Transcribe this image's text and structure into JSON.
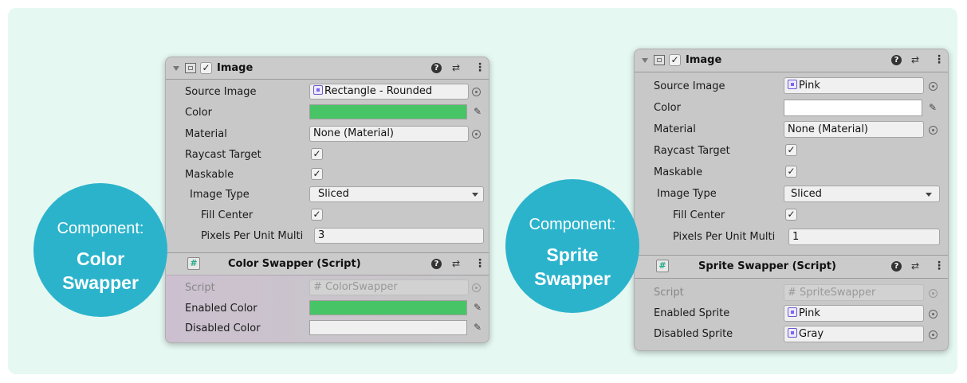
{
  "left": {
    "badge": {
      "line1": "Component:",
      "line2": "Color",
      "line3": "Swapper"
    },
    "image_component": {
      "title": "Image",
      "source_image": {
        "label": "Source Image",
        "value": "Rectangle - Rounded"
      },
      "color": {
        "label": "Color",
        "value_hex": "#47c566"
      },
      "material": {
        "label": "Material",
        "value": "None (Material)"
      },
      "raycast": {
        "label": "Raycast Target",
        "checked": "✓"
      },
      "maskable": {
        "label": "Maskable",
        "checked": "✓"
      },
      "image_type": {
        "label": "Image Type",
        "value": "Sliced"
      },
      "fill_center": {
        "label": "Fill Center",
        "checked": "✓"
      },
      "ppu": {
        "label": "Pixels Per Unit Multi",
        "value": "3"
      }
    },
    "script_component": {
      "title": "Color Swapper (Script)",
      "script": {
        "label": "Script",
        "value": "ColorSwapper"
      },
      "enabled": {
        "label": "Enabled Color",
        "value_hex": "#47c566"
      },
      "disabled": {
        "label": "Disabled Color",
        "value_hex": "#f0f0f0"
      }
    }
  },
  "right": {
    "badge": {
      "line1": "Component:",
      "line2": "Sprite",
      "line3": "Swapper"
    },
    "image_component": {
      "title": "Image",
      "source_image": {
        "label": "Source Image",
        "value": "Pink"
      },
      "color": {
        "label": "Color",
        "value_hex": "#ffffff"
      },
      "material": {
        "label": "Material",
        "value": "None (Material)"
      },
      "raycast": {
        "label": "Raycast Target",
        "checked": "✓"
      },
      "maskable": {
        "label": "Maskable",
        "checked": "✓"
      },
      "image_type": {
        "label": "Image Type",
        "value": "Sliced"
      },
      "fill_center": {
        "label": "Fill Center",
        "checked": "✓"
      },
      "ppu": {
        "label": "Pixels Per Unit Multi",
        "value": "1"
      }
    },
    "script_component": {
      "title": "Sprite Swapper (Script)",
      "script": {
        "label": "Script",
        "value": "SpriteSwapper"
      },
      "enabled": {
        "label": "Enabled Sprite",
        "value": "Pink"
      },
      "disabled": {
        "label": "Disabled Sprite",
        "value": "Gray"
      }
    }
  },
  "colors": {
    "background": "#e6f8f2",
    "badge": "#2bb3cc",
    "panel": "#c8c8c8"
  },
  "icons": {
    "help": "?",
    "presets": "⇄",
    "kebab": "⋮",
    "check": "✓",
    "eyedropper": "✎",
    "script_hash": "#"
  }
}
